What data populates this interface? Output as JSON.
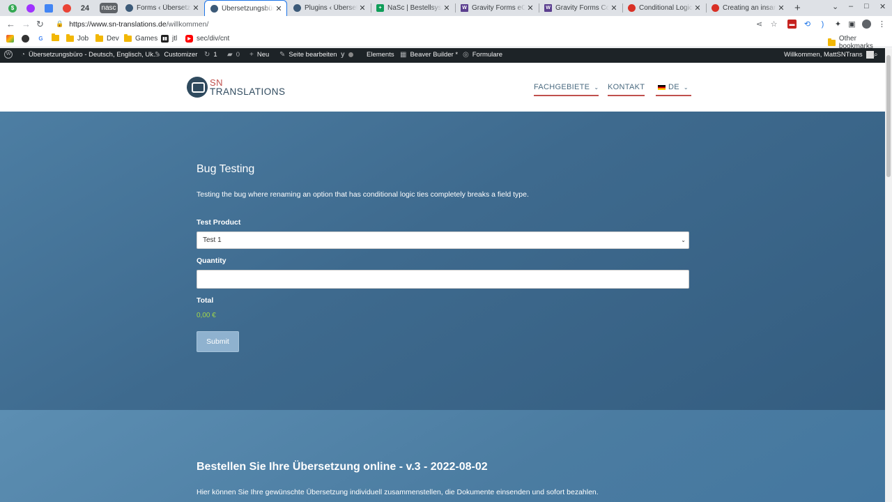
{
  "browser": {
    "pinned": [
      {
        "icon": "green-dollar-icon",
        "text": "$",
        "color": "#34a853"
      },
      {
        "icon": "messenger-icon",
        "text": "",
        "color": "#a033ff"
      },
      {
        "icon": "calendar-icon",
        "text": "",
        "color": "#4285f4"
      },
      {
        "icon": "refresh-badge-icon",
        "text": "",
        "color": "#ea4335"
      },
      {
        "icon": "calendar-day-icon",
        "text": "24",
        "color": "#1a73e8"
      }
    ],
    "group_chip": "nasc",
    "tabs": [
      {
        "title": "Forms ‹ Übersetzungsbüro",
        "active": false,
        "favicon": "wordpress-icon",
        "color": "#3c5a78"
      },
      {
        "title": "Übersetzungsbüro",
        "active": true,
        "favicon": "wordpress-icon",
        "color": "#3c5a78"
      },
      {
        "title": "Plugins ‹ Übersetzungsbüro",
        "active": false,
        "favicon": "wordpress-icon",
        "color": "#3c5a78"
      },
      {
        "title": "NaSc | Bestellsystem",
        "active": false,
        "favicon": "sheets-icon",
        "color": "#0f9d58"
      },
      {
        "title": "Gravity Forms eCommerce",
        "active": false,
        "favicon": "w-icon",
        "color": "#5b3f8f"
      },
      {
        "title": "Gravity Forms Conditional",
        "active": false,
        "favicon": "w-icon",
        "color": "#5b3f8f"
      },
      {
        "title": "Conditional Logic Bug",
        "active": false,
        "favicon": "support-icon",
        "color": "#d93025"
      },
      {
        "title": "Creating an insanely",
        "active": false,
        "favicon": "support-icon",
        "color": "#d93025"
      }
    ],
    "url_host": "https://www.sn-translations.de",
    "url_path": "/willkommen/",
    "bookmarks": [
      {
        "label": "",
        "icon": "colorful-app-icon"
      },
      {
        "label": "",
        "icon": "panda-icon"
      },
      {
        "label": "",
        "icon": "google-icon"
      },
      {
        "label": "",
        "icon": "folder-icon"
      },
      {
        "label": "Job",
        "icon": "folder-icon"
      },
      {
        "label": "Dev",
        "icon": "folder-icon"
      },
      {
        "label": "Games",
        "icon": "folder-icon"
      },
      {
        "label": "jtl",
        "icon": "jtl-icon"
      },
      {
        "label": "sec/div/cnt",
        "icon": "youtube-icon"
      }
    ],
    "other_bookmarks": "Other bookmarks"
  },
  "adminbar": {
    "site_name": "Übersetzungsbüro - Deutsch, Englisch, Uk...",
    "customizer": "Customizer",
    "updates_count": "1",
    "comments_count": "0",
    "new": "Neu",
    "edit_page": "Seite bearbeiten",
    "elements": "Elements",
    "beaver_builder": "Beaver Builder *",
    "forms": "Formulare",
    "welcome": "Willkommen, MattSNTrans"
  },
  "site": {
    "logo_sn": "SN",
    "logo_translations": "TRANSLATIONS",
    "menu": {
      "fachgebiete": "FACHGEBIETE",
      "kontakt": "KONTAKT",
      "language": "DE"
    }
  },
  "form": {
    "title": "Bug Testing",
    "description": "Testing the bug where renaming an option that has conditional logic ties completely breaks a field type.",
    "product_label": "Test Product",
    "product_value": "Test 1",
    "quantity_label": "Quantity",
    "quantity_value": "",
    "total_label": "Total",
    "total_value": "0,00 €",
    "submit_label": "Submit"
  },
  "section2": {
    "title": "Bestellen Sie Ihre Übersetzung online - v.3 - 2022-08-02",
    "text": "Hier können Sie Ihre gewünschte Übersetzung individuell zusammenstellen, die Dokumente einsenden und sofort bezahlen."
  },
  "colors": {
    "accent_red": "#c0504d",
    "brand_navy": "#2f4a5e",
    "total_green": "#a2d64a",
    "adminbar_bg": "#1d2327"
  }
}
